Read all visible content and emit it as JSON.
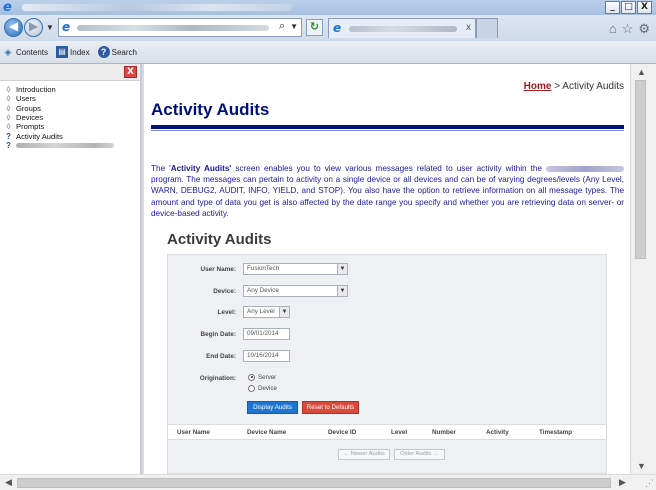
{
  "browser": {
    "back_glyph": "◀",
    "forward_glyph": "▶",
    "search_glyph": "⌕",
    "refresh_glyph": "↻",
    "close_tab_glyph": "x",
    "window_buttons": [
      "_",
      "□",
      "X"
    ],
    "toolbar_icons": [
      "⌂",
      "☆",
      "⚙"
    ]
  },
  "help_toolbar": {
    "contents_label": "Contents",
    "index_label": "Index",
    "search_label": "Search"
  },
  "tree": {
    "close_glyph": "X",
    "items": [
      {
        "label": "Introduction",
        "icon": "book-icon"
      },
      {
        "label": "Users",
        "icon": "book-icon"
      },
      {
        "label": "Groups",
        "icon": "book-icon"
      },
      {
        "label": "Devices",
        "icon": "book-icon"
      },
      {
        "label": "Prompts",
        "icon": "book-icon"
      },
      {
        "label": "Activity Audits",
        "icon": "help-page-icon"
      }
    ]
  },
  "content": {
    "breadcrumb_home": "Home",
    "breadcrumb_sep": " > ",
    "breadcrumb_current": "Activity Audits",
    "title": "Activity Audits",
    "intro_lead": "The '",
    "intro_term": "Activity Audits'",
    "intro_part1": " screen enables you to view various messages related to user activity within the ",
    "intro_part2": " program. The messages can pertain to activity on a single device or all devices and can be of varying degrees/levels (Any Level, WARN, DEBUG2, AUDIT, INFO, YIELD, and STOP). You also have the option to retrieve information on all message types. The amount and type of data you get is also affected by the date range you specify and whether you are retrieving data on server- or device-based activity."
  },
  "shot": {
    "title": "Activity Audits",
    "fields": {
      "user_name_label": "User Name:",
      "user_name_value": "FusionTech",
      "device_label": "Device:",
      "device_value": "Any Device",
      "level_label": "Level:",
      "level_value": "Any Level",
      "begin_date_label": "Begin Date:",
      "begin_date_value": "09/01/2014",
      "end_date_label": "End Date:",
      "end_date_value": "10/16/2014",
      "origination_label": "Origination:",
      "origination_options": [
        "Server",
        "Device"
      ],
      "origination_selected": "Server"
    },
    "buttons": {
      "display": "Display Audits",
      "reset": "Reset to Defaults",
      "newer": "← Newer Audits",
      "older": "Older Audits →"
    },
    "columns": [
      "User Name",
      "Device Name",
      "Device ID",
      "Level",
      "Number",
      "Activity",
      "Timestamp"
    ]
  },
  "scrollbars": {
    "up": "▲",
    "down": "▼",
    "left": "◀",
    "right": "▶"
  }
}
